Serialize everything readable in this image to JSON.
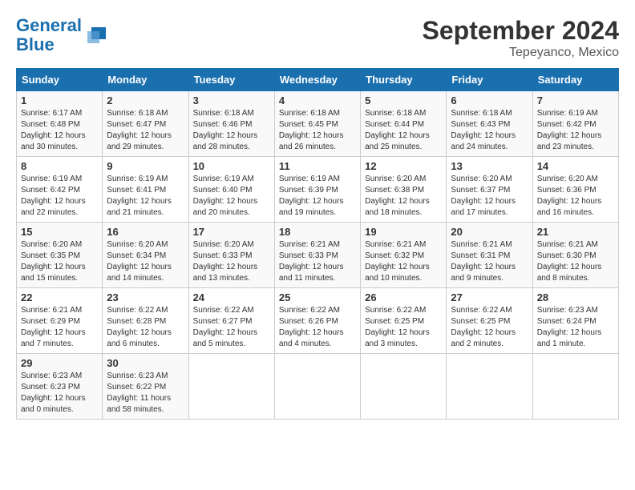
{
  "header": {
    "logo_line1": "General",
    "logo_line2": "Blue",
    "month": "September 2024",
    "location": "Tepeyanco, Mexico"
  },
  "weekdays": [
    "Sunday",
    "Monday",
    "Tuesday",
    "Wednesday",
    "Thursday",
    "Friday",
    "Saturday"
  ],
  "weeks": [
    [
      {
        "day": "1",
        "sunrise": "Sunrise: 6:17 AM",
        "sunset": "Sunset: 6:48 PM",
        "daylight": "Daylight: 12 hours and 30 minutes."
      },
      {
        "day": "2",
        "sunrise": "Sunrise: 6:18 AM",
        "sunset": "Sunset: 6:47 PM",
        "daylight": "Daylight: 12 hours and 29 minutes."
      },
      {
        "day": "3",
        "sunrise": "Sunrise: 6:18 AM",
        "sunset": "Sunset: 6:46 PM",
        "daylight": "Daylight: 12 hours and 28 minutes."
      },
      {
        "day": "4",
        "sunrise": "Sunrise: 6:18 AM",
        "sunset": "Sunset: 6:45 PM",
        "daylight": "Daylight: 12 hours and 26 minutes."
      },
      {
        "day": "5",
        "sunrise": "Sunrise: 6:18 AM",
        "sunset": "Sunset: 6:44 PM",
        "daylight": "Daylight: 12 hours and 25 minutes."
      },
      {
        "day": "6",
        "sunrise": "Sunrise: 6:18 AM",
        "sunset": "Sunset: 6:43 PM",
        "daylight": "Daylight: 12 hours and 24 minutes."
      },
      {
        "day": "7",
        "sunrise": "Sunrise: 6:19 AM",
        "sunset": "Sunset: 6:42 PM",
        "daylight": "Daylight: 12 hours and 23 minutes."
      }
    ],
    [
      {
        "day": "8",
        "sunrise": "Sunrise: 6:19 AM",
        "sunset": "Sunset: 6:42 PM",
        "daylight": "Daylight: 12 hours and 22 minutes."
      },
      {
        "day": "9",
        "sunrise": "Sunrise: 6:19 AM",
        "sunset": "Sunset: 6:41 PM",
        "daylight": "Daylight: 12 hours and 21 minutes."
      },
      {
        "day": "10",
        "sunrise": "Sunrise: 6:19 AM",
        "sunset": "Sunset: 6:40 PM",
        "daylight": "Daylight: 12 hours and 20 minutes."
      },
      {
        "day": "11",
        "sunrise": "Sunrise: 6:19 AM",
        "sunset": "Sunset: 6:39 PM",
        "daylight": "Daylight: 12 hours and 19 minutes."
      },
      {
        "day": "12",
        "sunrise": "Sunrise: 6:20 AM",
        "sunset": "Sunset: 6:38 PM",
        "daylight": "Daylight: 12 hours and 18 minutes."
      },
      {
        "day": "13",
        "sunrise": "Sunrise: 6:20 AM",
        "sunset": "Sunset: 6:37 PM",
        "daylight": "Daylight: 12 hours and 17 minutes."
      },
      {
        "day": "14",
        "sunrise": "Sunrise: 6:20 AM",
        "sunset": "Sunset: 6:36 PM",
        "daylight": "Daylight: 12 hours and 16 minutes."
      }
    ],
    [
      {
        "day": "15",
        "sunrise": "Sunrise: 6:20 AM",
        "sunset": "Sunset: 6:35 PM",
        "daylight": "Daylight: 12 hours and 15 minutes."
      },
      {
        "day": "16",
        "sunrise": "Sunrise: 6:20 AM",
        "sunset": "Sunset: 6:34 PM",
        "daylight": "Daylight: 12 hours and 14 minutes."
      },
      {
        "day": "17",
        "sunrise": "Sunrise: 6:20 AM",
        "sunset": "Sunset: 6:33 PM",
        "daylight": "Daylight: 12 hours and 13 minutes."
      },
      {
        "day": "18",
        "sunrise": "Sunrise: 6:21 AM",
        "sunset": "Sunset: 6:33 PM",
        "daylight": "Daylight: 12 hours and 11 minutes."
      },
      {
        "day": "19",
        "sunrise": "Sunrise: 6:21 AM",
        "sunset": "Sunset: 6:32 PM",
        "daylight": "Daylight: 12 hours and 10 minutes."
      },
      {
        "day": "20",
        "sunrise": "Sunrise: 6:21 AM",
        "sunset": "Sunset: 6:31 PM",
        "daylight": "Daylight: 12 hours and 9 minutes."
      },
      {
        "day": "21",
        "sunrise": "Sunrise: 6:21 AM",
        "sunset": "Sunset: 6:30 PM",
        "daylight": "Daylight: 12 hours and 8 minutes."
      }
    ],
    [
      {
        "day": "22",
        "sunrise": "Sunrise: 6:21 AM",
        "sunset": "Sunset: 6:29 PM",
        "daylight": "Daylight: 12 hours and 7 minutes."
      },
      {
        "day": "23",
        "sunrise": "Sunrise: 6:22 AM",
        "sunset": "Sunset: 6:28 PM",
        "daylight": "Daylight: 12 hours and 6 minutes."
      },
      {
        "day": "24",
        "sunrise": "Sunrise: 6:22 AM",
        "sunset": "Sunset: 6:27 PM",
        "daylight": "Daylight: 12 hours and 5 minutes."
      },
      {
        "day": "25",
        "sunrise": "Sunrise: 6:22 AM",
        "sunset": "Sunset: 6:26 PM",
        "daylight": "Daylight: 12 hours and 4 minutes."
      },
      {
        "day": "26",
        "sunrise": "Sunrise: 6:22 AM",
        "sunset": "Sunset: 6:25 PM",
        "daylight": "Daylight: 12 hours and 3 minutes."
      },
      {
        "day": "27",
        "sunrise": "Sunrise: 6:22 AM",
        "sunset": "Sunset: 6:25 PM",
        "daylight": "Daylight: 12 hours and 2 minutes."
      },
      {
        "day": "28",
        "sunrise": "Sunrise: 6:23 AM",
        "sunset": "Sunset: 6:24 PM",
        "daylight": "Daylight: 12 hours and 1 minute."
      }
    ],
    [
      {
        "day": "29",
        "sunrise": "Sunrise: 6:23 AM",
        "sunset": "Sunset: 6:23 PM",
        "daylight": "Daylight: 12 hours and 0 minutes."
      },
      {
        "day": "30",
        "sunrise": "Sunrise: 6:23 AM",
        "sunset": "Sunset: 6:22 PM",
        "daylight": "Daylight: 11 hours and 58 minutes."
      },
      null,
      null,
      null,
      null,
      null
    ]
  ]
}
